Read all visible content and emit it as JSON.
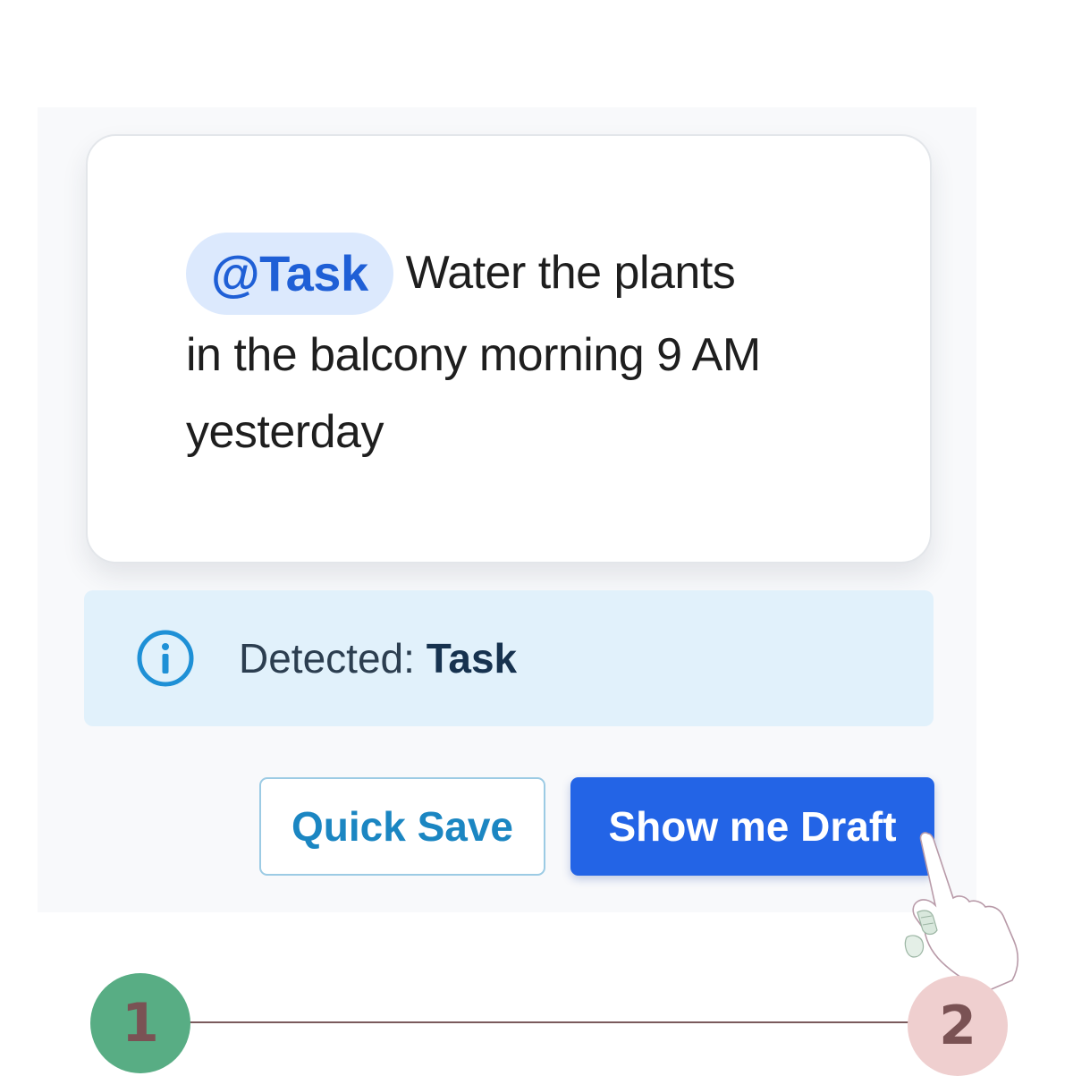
{
  "note": {
    "mention": "@Task",
    "text_line1": "Water the plants",
    "text_line2": "in the balcony morning 9 AM",
    "text_line3": "yesterday"
  },
  "detection": {
    "icon": "info-icon",
    "label": "Detected: ",
    "value": "Task"
  },
  "actions": {
    "quick_save_label": "Quick Save",
    "show_draft_label": "Show me Draft"
  },
  "stepper": {
    "steps": [
      "1",
      "2"
    ],
    "current_step": 2
  },
  "colors": {
    "accent": "#2364e6",
    "mention_chip_bg": "#dce9fd",
    "detect_bar_bg": "#e1f1fb",
    "quick_save_text": "#1b86c2",
    "step_done": "#58ad84",
    "step_current": "#efcfcf"
  }
}
